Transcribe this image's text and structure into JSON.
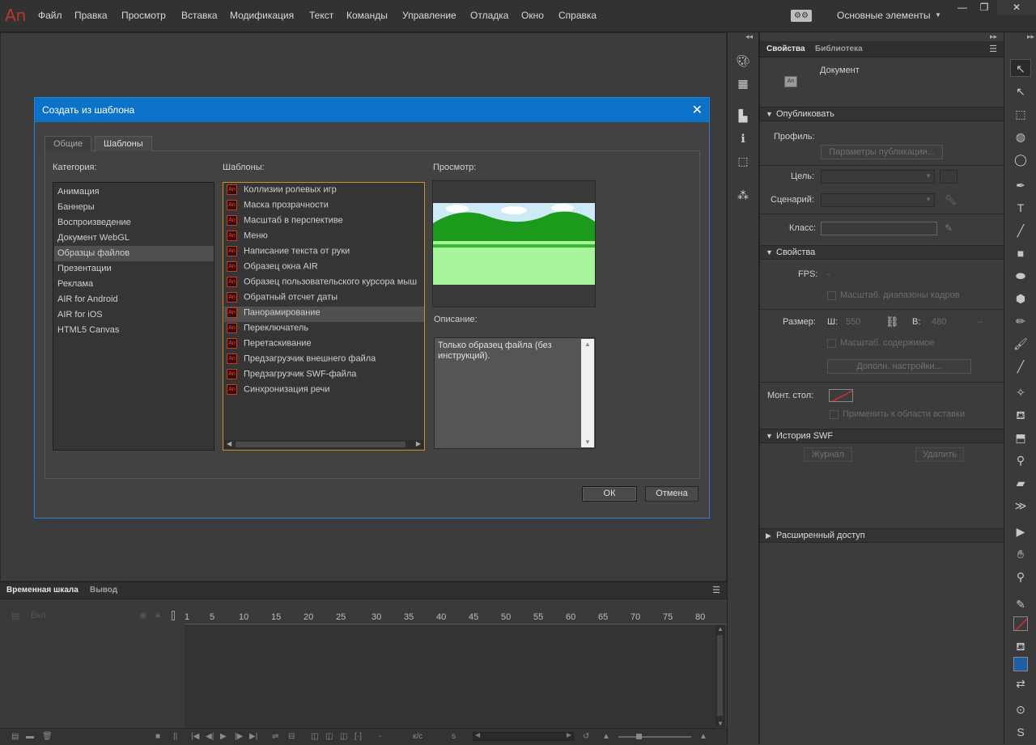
{
  "app": {
    "logo": "An",
    "menu": [
      "Файл",
      "Правка",
      "Просмотр",
      "Вставка",
      "Модификация",
      "Текст",
      "Команды",
      "Управление",
      "Отладка",
      "Окно",
      "Справка"
    ],
    "workspace": "Основные элементы",
    "window_controls": [
      "—",
      "❐",
      "✕"
    ]
  },
  "dialog": {
    "title": "Создать из шаблона",
    "close": "✕",
    "tabs": [
      "Общие",
      "Шаблоны"
    ],
    "category_label": "Категория:",
    "categories": [
      "Анимация",
      "Баннеры",
      "Воспроизведение",
      "Документ WebGL",
      "Образцы файлов",
      "Презентации",
      "Реклама",
      "AIR for Android",
      "AIR for iOS",
      "HTML5 Canvas"
    ],
    "selected_category": "Образцы файлов",
    "templates_label": "Шаблоны:",
    "templates": [
      "Коллизии ролевых игр",
      "Маска прозрачности",
      "Масштаб в перспективе",
      "Меню",
      "Написание текста от руки",
      "Образец окна AIR",
      "Образец пользовательского курсора мыш",
      "Обратный отсчет даты",
      "Панорамирование",
      "Переключатель",
      "Перетаскивание",
      "Предзагрузчик внешнего файла",
      "Предзагрузчик SWF-файла",
      "Синхронизация речи"
    ],
    "selected_template": "Панорамирование",
    "template_icon": "An",
    "preview_label": "Просмотр:",
    "description_label": "Описание:",
    "description": "Только образец файла (без инструкций).",
    "ok": "ОК",
    "cancel": "Отмена"
  },
  "timeline": {
    "tabs": [
      "Временная шкала",
      "Вывод"
    ],
    "layer_label": "Вкл.",
    "ticks": [
      "1",
      "5",
      "10",
      "15",
      "20",
      "25",
      "30",
      "35",
      "40",
      "45",
      "50",
      "55",
      "60",
      "65",
      "70",
      "75",
      "80"
    ],
    "fps_unit": "к/с"
  },
  "properties": {
    "tabs": [
      "Свойства",
      "Библиотека"
    ],
    "doc_label": "Документ",
    "doc_icon": "An",
    "publish_section": "Опубликовать",
    "profile_label": "Профиль:",
    "publish_settings_btn": "Параметры публикации...",
    "target_label": "Цель:",
    "script_label": "Сценарий:",
    "class_label": "Класс:",
    "props_section": "Свойства",
    "fps_label": "FPS:",
    "fps_value": "-",
    "scale_spans": "Масштаб. диапазоны кадров",
    "size_label": "Размер:",
    "w_label": "Ш:",
    "width": "550",
    "h_label": "В:",
    "height": "480",
    "size_unit": "--",
    "scale_content": "Масштаб. содержимое",
    "advanced_btn": "Дополн. настройки...",
    "stage_label": "Монт. стол:",
    "apply_paste": "Применить к области вставки",
    "swf_history": "История SWF",
    "log_btn": "Журнал",
    "delete_btn": "Удалить",
    "accessibility": "Расширенный доступ"
  },
  "colors": {
    "accent": "#0b72c8",
    "logo": "#b23a2c",
    "list_focus": "#c8922a",
    "fill_swatch": "#1f5fa8"
  }
}
